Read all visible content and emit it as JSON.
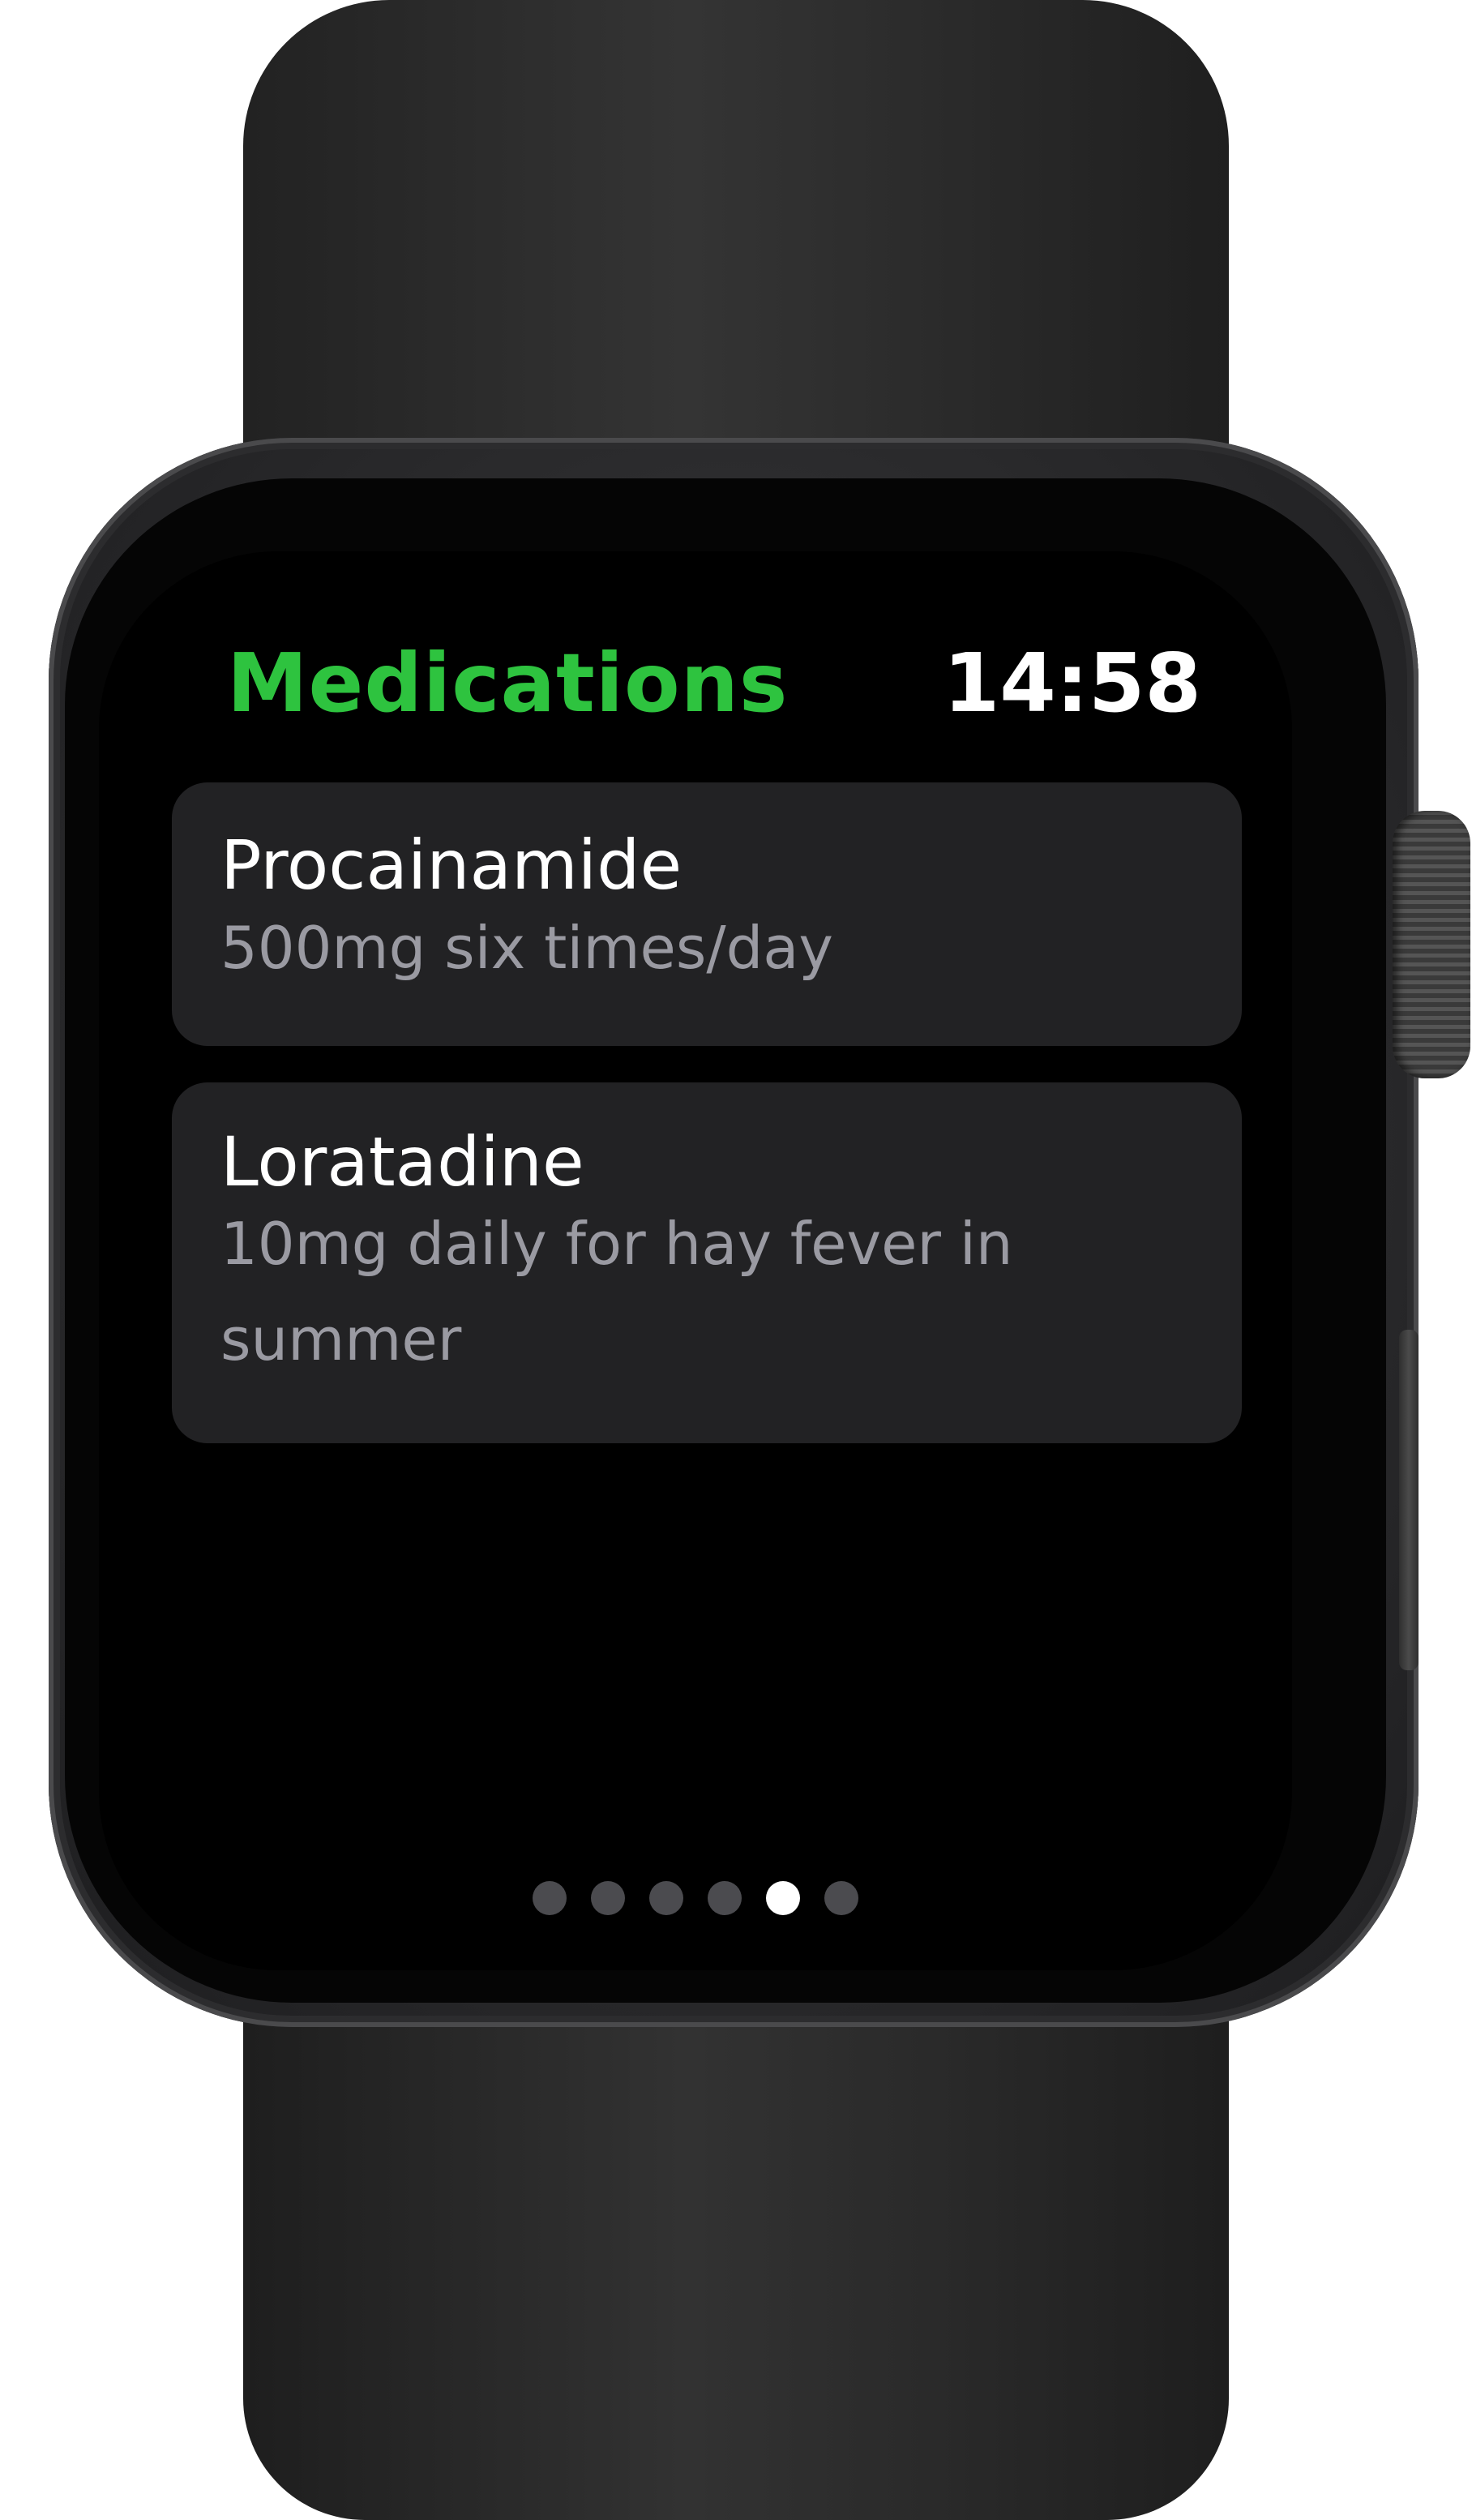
{
  "app": {
    "title": "Medications",
    "time": "14:58",
    "title_color": "#2EC33F"
  },
  "medications": [
    {
      "name": "Procainamide",
      "dosage": "500mg six times/day"
    },
    {
      "name": "Loratadine",
      "dosage": "10mg daily for hay fever in summer"
    }
  ],
  "pager": {
    "page_count": 6,
    "current_page": 5
  }
}
